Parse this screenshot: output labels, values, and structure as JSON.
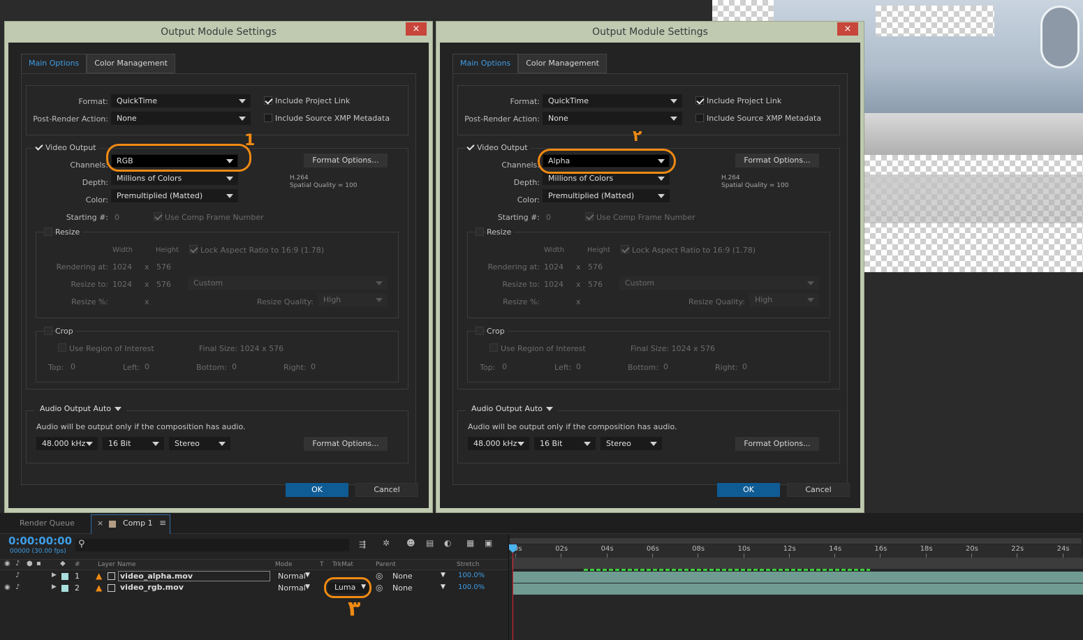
{
  "dialogs": [
    {
      "title": "Output Module Settings",
      "close": "×",
      "tabs": [
        "Main Options",
        "Color Management"
      ],
      "format_label": "Format:",
      "format": "QuickTime",
      "post_render_label": "Post-Render Action:",
      "post_render": "None",
      "include_project_link": "Include Project Link",
      "include_xmp": "Include Source XMP Metadata",
      "video_output": "Video Output",
      "channels_label": "Channels:",
      "channels": "RGB",
      "depth_label": "Depth:",
      "depth": "Millions of Colors",
      "color_label": "Color:",
      "color": "Premultiplied (Matted)",
      "starting_label": "Starting #:",
      "starting": "0",
      "use_comp_frame": "Use Comp Frame Number",
      "format_options": "Format Options...",
      "codec": "H.264",
      "spatial": "Spatial Quality = 100",
      "resize": "Resize",
      "width": "Width",
      "height": "Height",
      "lock_aspect": "Lock Aspect Ratio to 16:9 (1.78)",
      "rendering_at": "Rendering at:",
      "render_w": "1024",
      "render_h": "576",
      "x": "x",
      "resize_to": "Resize to:",
      "resize_w": "1024",
      "resize_h": "576",
      "custom": "Custom",
      "resize_pct": "Resize %:",
      "resize_quality_label": "Resize Quality:",
      "resize_quality": "High",
      "crop": "Crop",
      "use_roi": "Use Region of Interest",
      "final_size": "Final Size: 1024 x 576",
      "top": "Top:",
      "top_v": "0",
      "left": "Left:",
      "left_v": "0",
      "bottom": "Bottom:",
      "bottom_v": "0",
      "right": "Right:",
      "right_v": "0",
      "audio_output": "Audio Output Auto",
      "audio_note": "Audio will be output only if the composition has audio.",
      "khz": "48.000 kHz",
      "bit": "16 Bit",
      "stereo": "Stereo",
      "audio_format_options": "Format Options...",
      "ok": "OK",
      "cancel": "Cancel",
      "annotation": "1"
    },
    {
      "title": "Output Module Settings",
      "close": "×",
      "tabs": [
        "Main Options",
        "Color Management"
      ],
      "format_label": "Format:",
      "format": "QuickTime",
      "post_render_label": "Post-Render Action:",
      "post_render": "None",
      "include_project_link": "Include Project Link",
      "include_xmp": "Include Source XMP Metadata",
      "video_output": "Video Output",
      "channels_label": "Channels:",
      "channels": "Alpha",
      "depth_label": "Depth:",
      "depth": "Millions of Colors",
      "color_label": "Color:",
      "color": "Premultiplied (Matted)",
      "starting_label": "Starting #:",
      "starting": "0",
      "use_comp_frame": "Use Comp Frame Number",
      "format_options": "Format Options...",
      "codec": "H.264",
      "spatial": "Spatial Quality = 100",
      "resize": "Resize",
      "width": "Width",
      "height": "Height",
      "lock_aspect": "Lock Aspect Ratio to 16:9 (1.78)",
      "rendering_at": "Rendering at:",
      "render_w": "1024",
      "render_h": "576",
      "x": "x",
      "resize_to": "Resize to:",
      "resize_w": "1024",
      "resize_h": "576",
      "custom": "Custom",
      "resize_pct": "Resize %:",
      "resize_quality_label": "Resize Quality:",
      "resize_quality": "High",
      "crop": "Crop",
      "use_roi": "Use Region of Interest",
      "final_size": "Final Size: 1024 x 576",
      "top": "Top:",
      "top_v": "0",
      "left": "Left:",
      "left_v": "0",
      "bottom": "Bottom:",
      "bottom_v": "0",
      "right": "Right:",
      "right_v": "0",
      "audio_output": "Audio Output Auto",
      "audio_note": "Audio will be output only if the composition has audio.",
      "khz": "48.000 kHz",
      "bit": "16 Bit",
      "stereo": "Stereo",
      "audio_format_options": "Format Options...",
      "ok": "OK",
      "cancel": "Cancel",
      "annotation": "٢"
    }
  ],
  "timeline": {
    "tabs": [
      "Render Queue",
      "Comp 1"
    ],
    "close": "×",
    "menu": "≡",
    "timecode": "0:00:00:00",
    "fps": "00000 (30.00 fps)",
    "search_icon": "⚲",
    "headers": {
      "layer_name": "Layer Name",
      "mode": "Mode",
      "t": "T",
      "trkmat": "TrkMat",
      "parent": "Parent",
      "stretch": "Stretch",
      "num": "#"
    },
    "ruler": [
      "0s",
      "02s",
      "04s",
      "06s",
      "08s",
      "10s",
      "12s",
      "14s",
      "16s",
      "18s",
      "20s",
      "22s",
      "24s"
    ],
    "layers": [
      {
        "num": "1",
        "name": "video_alpha.mov",
        "mode": "Normal",
        "trkmat": "",
        "parent": "None",
        "stretch": "100.0%"
      },
      {
        "num": "2",
        "name": "video_rgb.mov",
        "mode": "Normal",
        "trkmat": "Luma",
        "parent": "None",
        "stretch": "100.0%"
      }
    ],
    "annotation": "٣",
    "colors": {
      "accent": "#3d9de6",
      "annotation": "#f08a12",
      "track": "#6f9b93"
    }
  }
}
